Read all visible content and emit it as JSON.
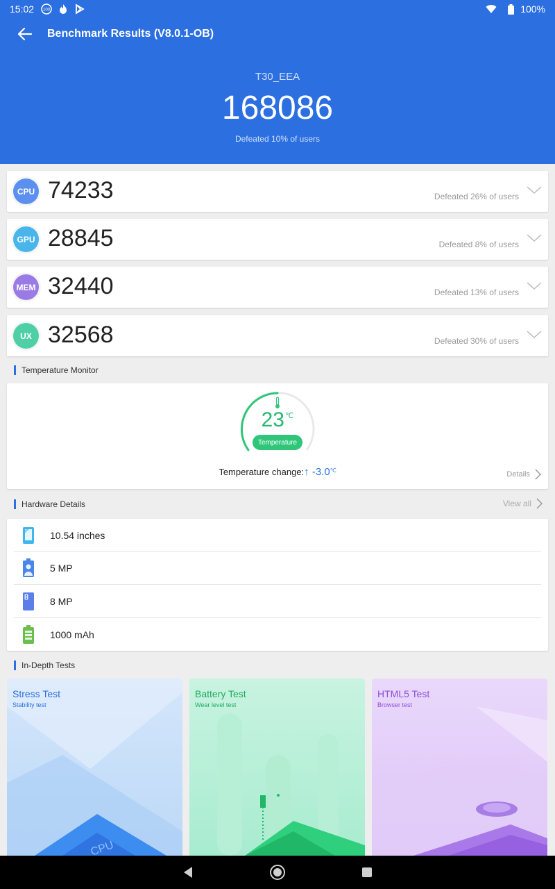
{
  "status_bar": {
    "time": "15:02",
    "badge_number": "100",
    "battery_text": "100%"
  },
  "app_bar": {
    "title": "Benchmark Results (V8.0.1-OB)"
  },
  "summary": {
    "device_name": "T30_EEA",
    "total_score": "168086",
    "defeated_text": "Defeated 10% of users"
  },
  "scores": [
    {
      "label": "CPU",
      "value": "74233",
      "defeated": "Defeated 26% of users",
      "color": "#5b8ff0"
    },
    {
      "label": "GPU",
      "value": "28845",
      "defeated": "Defeated 8% of users",
      "color": "#49b5ea"
    },
    {
      "label": "MEM",
      "value": "32440",
      "defeated": "Defeated 13% of users",
      "color": "#9a7be6"
    },
    {
      "label": "UX",
      "value": "32568",
      "defeated": "Defeated 30% of users",
      "color": "#4fcfa6"
    }
  ],
  "temperature": {
    "section_title": "Temperature Monitor",
    "value": "23",
    "unit": "℃",
    "pill_label": "Temperature",
    "change_label": "Temperature change:",
    "change_value": "↑ -3.0",
    "change_unit": "℃",
    "details_label": "Details"
  },
  "hardware": {
    "section_title": "Hardware Details",
    "view_all_label": "View all",
    "items": [
      {
        "text": "10.54 inches",
        "icon": "screen-icon"
      },
      {
        "text": "5 MP",
        "icon": "front-camera-icon"
      },
      {
        "text": "8 MP",
        "icon": "rear-camera-icon"
      },
      {
        "text": "1000 mAh",
        "icon": "battery-icon"
      }
    ]
  },
  "in_depth": {
    "section_title": "In-Depth Tests",
    "tests": [
      {
        "title": "Stress Test",
        "subtitle": "Stability test",
        "color": "#2c6fe0"
      },
      {
        "title": "Battery Test",
        "subtitle": "Wear level test",
        "color": "#1faa5f"
      },
      {
        "title": "HTML5 Test",
        "subtitle": "Browser test",
        "color": "#8a4fd8"
      }
    ]
  },
  "colors": {
    "header_blue": "#2c6fe0",
    "temperature_green": "#2fc67a"
  }
}
